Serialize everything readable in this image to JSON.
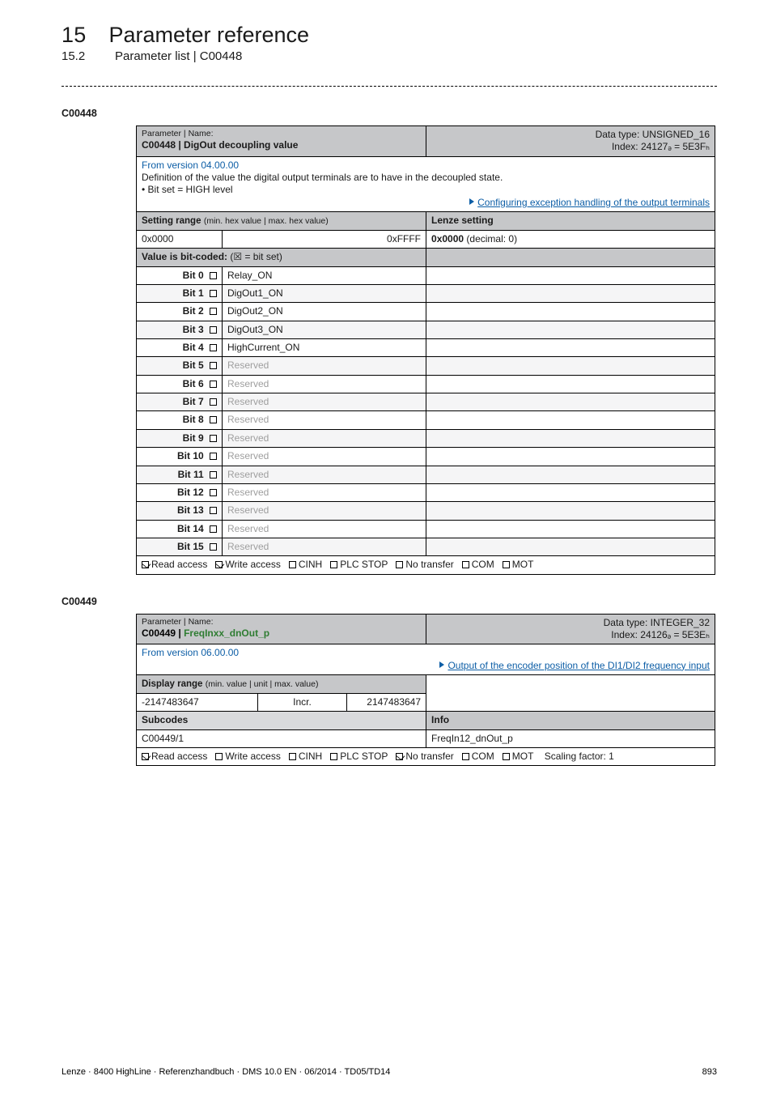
{
  "header": {
    "chapter_num": "15",
    "chapter_title": "Parameter reference",
    "section_num": "15.2",
    "section_title": "Parameter list | C00448"
  },
  "table1": {
    "code": "C00448",
    "param_label": "Parameter | Name:",
    "param_name": "C00448 | DigOut decoupling value",
    "dtype_line1": "Data type: UNSIGNED_16",
    "dtype_line2": "Index: 24127ₔ = 5E3Fₕ",
    "from_version": "From version 04.00.00",
    "definition": "Definition of the value the digital output terminals are to have in the decoupled state.",
    "bullet1": " • Bit set = HIGH level",
    "config_link": "Configuring exception handling of the output terminals",
    "setting_range_label": "Setting range",
    "setting_range_paren": "(min. hex value | max. hex value)",
    "lenze_setting_label": "Lenze setting",
    "hex_min": "0x0000",
    "hex_max": "0xFFFF",
    "lenze_value_bold": "0x0000",
    "lenze_value_rest": "  (decimal: 0)",
    "bitcoded_label": "Value is bit-coded:",
    "bitcoded_hint": "(☒ = bit set)",
    "bits": [
      {
        "idx": "Bit 0",
        "val": "Relay_ON",
        "muted": false
      },
      {
        "idx": "Bit 1",
        "val": "DigOut1_ON",
        "muted": false
      },
      {
        "idx": "Bit 2",
        "val": "DigOut2_ON",
        "muted": false
      },
      {
        "idx": "Bit 3",
        "val": "DigOut3_ON",
        "muted": false
      },
      {
        "idx": "Bit 4",
        "val": "HighCurrent_ON",
        "muted": false
      },
      {
        "idx": "Bit 5",
        "val": "Reserved",
        "muted": true
      },
      {
        "idx": "Bit 6",
        "val": "Reserved",
        "muted": true
      },
      {
        "idx": "Bit 7",
        "val": "Reserved",
        "muted": true
      },
      {
        "idx": "Bit 8",
        "val": "Reserved",
        "muted": true
      },
      {
        "idx": "Bit 9",
        "val": "Reserved",
        "muted": true
      },
      {
        "idx": "Bit 10",
        "val": "Reserved",
        "muted": true
      },
      {
        "idx": "Bit 11",
        "val": "Reserved",
        "muted": true
      },
      {
        "idx": "Bit 12",
        "val": "Reserved",
        "muted": true
      },
      {
        "idx": "Bit 13",
        "val": "Reserved",
        "muted": true
      },
      {
        "idx": "Bit 14",
        "val": "Reserved",
        "muted": true
      },
      {
        "idx": "Bit 15",
        "val": "Reserved",
        "muted": true
      }
    ],
    "access": {
      "read": {
        "label": "Read access",
        "checked": true
      },
      "write": {
        "label": "Write access",
        "checked": true
      },
      "cinh": {
        "label": "CINH",
        "checked": false
      },
      "plc": {
        "label": "PLC STOP",
        "checked": false
      },
      "notransfer": {
        "label": "No transfer",
        "checked": false
      },
      "com": {
        "label": "COM",
        "checked": false
      },
      "mot": {
        "label": "MOT",
        "checked": false
      }
    }
  },
  "table2": {
    "code": "C00449",
    "param_label": "Parameter | Name:",
    "param_name": "C00449 | FreqInxx_dnOut_p",
    "dtype_line1": "Data type: INTEGER_32",
    "dtype_line2": "Index: 24126ₔ = 5E3Eₕ",
    "from_version": "From version 06.00.00",
    "output_link": "Output of the encoder position of the DI1/DI2 frequency input",
    "display_range_label": "Display range",
    "display_range_paren": "(min. value | unit | max. value)",
    "min": "-2147483647",
    "unit": "Incr.",
    "max": "2147483647",
    "subcodes_label": "Subcodes",
    "info_label": "Info",
    "subcode": "C00449/1",
    "subcode_val": "FreqIn12_dnOut_p",
    "access": {
      "read": {
        "label": "Read access",
        "checked": true
      },
      "write": {
        "label": "Write access",
        "checked": false
      },
      "cinh": {
        "label": "CINH",
        "checked": false
      },
      "plc": {
        "label": "PLC STOP",
        "checked": false
      },
      "notransfer": {
        "label": "No transfer",
        "checked": true
      },
      "com": {
        "label": "COM",
        "checked": false
      },
      "mot": {
        "label": "MOT",
        "checked": false
      },
      "scaling": "Scaling factor: 1"
    }
  },
  "footer": {
    "left": "Lenze · 8400 HighLine · Referenzhandbuch · DMS 10.0 EN · 06/2014 · TD05/TD14",
    "page": "893"
  }
}
